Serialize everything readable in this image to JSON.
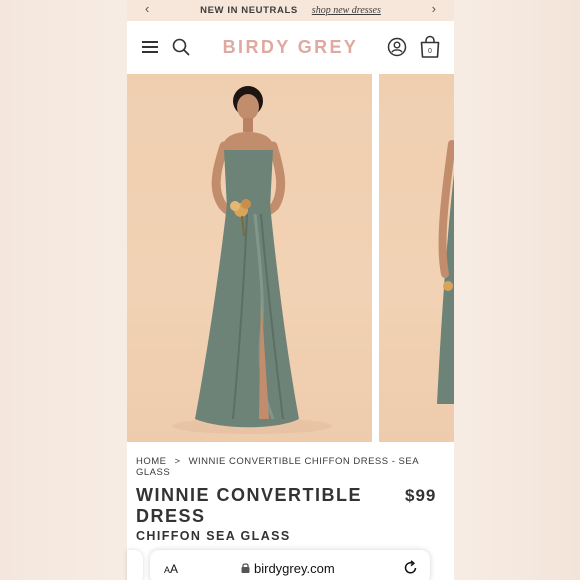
{
  "promo": {
    "text": "NEW IN NEUTRALS",
    "link": "shop new dresses"
  },
  "header": {
    "logo": "BIRDY GREY",
    "bag_count": "0"
  },
  "breadcrumb": {
    "home": "HOME",
    "separator": ">",
    "current": "WINNIE CONVERTIBLE CHIFFON DRESS - SEA GLASS"
  },
  "product": {
    "title": "WINNIE CONVERTIBLE DRESS",
    "price": "$99",
    "color": "CHIFFON SEA GLASS"
  },
  "browser": {
    "aa_small": "A",
    "aa_large": "A",
    "url": "birdygrey.com"
  },
  "colors": {
    "logo": "#e0a9a0",
    "promo_bg": "#f6e7da",
    "dress": "#6d8378",
    "photo_bg": "#f0cfb1"
  }
}
